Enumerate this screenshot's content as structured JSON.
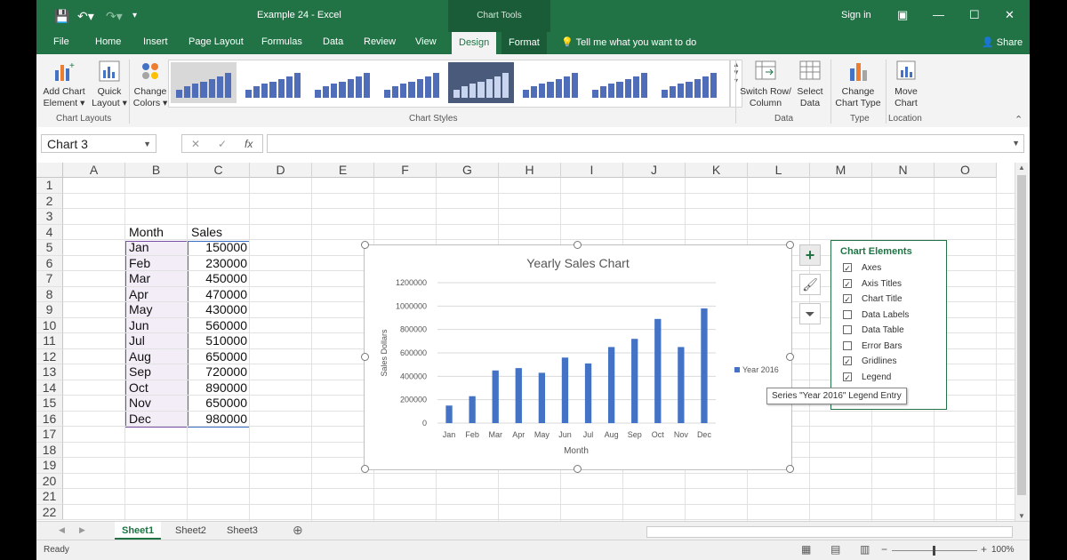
{
  "titlebar": {
    "doc_title": "Example 24  -  Excel",
    "context_tab": "Chart Tools",
    "signin": "Sign in"
  },
  "tabs": [
    "File",
    "Home",
    "Insert",
    "Page Layout",
    "Formulas",
    "Data",
    "Review",
    "View",
    "Design",
    "Format"
  ],
  "active_tab": "Design",
  "tell_me": "Tell me what you want to do",
  "share": "Share",
  "ribbon": {
    "add_chart_element": [
      "Add Chart",
      "Element ▾"
    ],
    "quick_layout": [
      "Quick",
      "Layout ▾"
    ],
    "change_colors": [
      "Change",
      "Colors ▾"
    ],
    "switch_row_col": [
      "Switch Row/",
      "Column"
    ],
    "select_data": [
      "Select",
      "Data"
    ],
    "change_chart_type": [
      "Change",
      "Chart Type"
    ],
    "move_chart": [
      "Move",
      "Chart"
    ],
    "groups": {
      "chart_layouts": "Chart Layouts",
      "chart_styles": "Chart Styles",
      "data": "Data",
      "type": "Type",
      "location": "Location"
    }
  },
  "formula_bar": {
    "name_box": "Chart 3",
    "formula": ""
  },
  "columns": [
    "A",
    "B",
    "C",
    "D",
    "E",
    "F",
    "G",
    "H",
    "I",
    "J",
    "K",
    "L",
    "M",
    "N",
    "O"
  ],
  "rows": [
    "1",
    "2",
    "3",
    "4",
    "5",
    "6",
    "7",
    "8",
    "9",
    "10",
    "11",
    "12",
    "13",
    "14",
    "15",
    "16",
    "17",
    "18",
    "19",
    "20",
    "21",
    "22"
  ],
  "table": {
    "header_month": "Month",
    "header_sales": "Sales",
    "months": [
      "Jan",
      "Feb",
      "Mar",
      "Apr",
      "May",
      "Jun",
      "Jul",
      "Aug",
      "Sep",
      "Oct",
      "Nov",
      "Dec"
    ],
    "sales": [
      "150000",
      "230000",
      "450000",
      "470000",
      "430000",
      "560000",
      "510000",
      "650000",
      "720000",
      "890000",
      "650000",
      "980000"
    ]
  },
  "chart_data": {
    "type": "bar",
    "title": "Yearly Sales Chart",
    "xlabel": "Month",
    "ylabel": "Sales Dollars",
    "categories": [
      "Jan",
      "Feb",
      "Mar",
      "Apr",
      "May",
      "Jun",
      "Jul",
      "Aug",
      "Sep",
      "Oct",
      "Nov",
      "Dec"
    ],
    "series": [
      {
        "name": "Year 2016",
        "values": [
          150000,
          230000,
          450000,
          470000,
          430000,
          560000,
          510000,
          650000,
          720000,
          890000,
          650000,
          980000
        ],
        "color": "#4472c4"
      }
    ],
    "yticks": [
      "0",
      "200000",
      "400000",
      "600000",
      "800000",
      "1000000",
      "1200000"
    ],
    "ylim": [
      0,
      1200000
    ],
    "grid": true,
    "legend": "right"
  },
  "chart_elements_panel": {
    "title": "Chart Elements",
    "items": [
      {
        "label": "Axes",
        "checked": true
      },
      {
        "label": "Axis Titles",
        "checked": true
      },
      {
        "label": "Chart Title",
        "checked": true
      },
      {
        "label": "Data Labels",
        "checked": false
      },
      {
        "label": "Data Table",
        "checked": false
      },
      {
        "label": "Error Bars",
        "checked": false
      },
      {
        "label": "Gridlines",
        "checked": true
      },
      {
        "label": "Legend",
        "checked": true
      }
    ]
  },
  "tooltip": "Series \"Year 2016\" Legend Entry",
  "sheets": [
    "Sheet1",
    "Sheet2",
    "Sheet3"
  ],
  "active_sheet": "Sheet1",
  "status": {
    "ready": "Ready",
    "zoom": "100%"
  },
  "colors": {
    "excel_green": "#217346",
    "bar_blue": "#4472c4"
  }
}
